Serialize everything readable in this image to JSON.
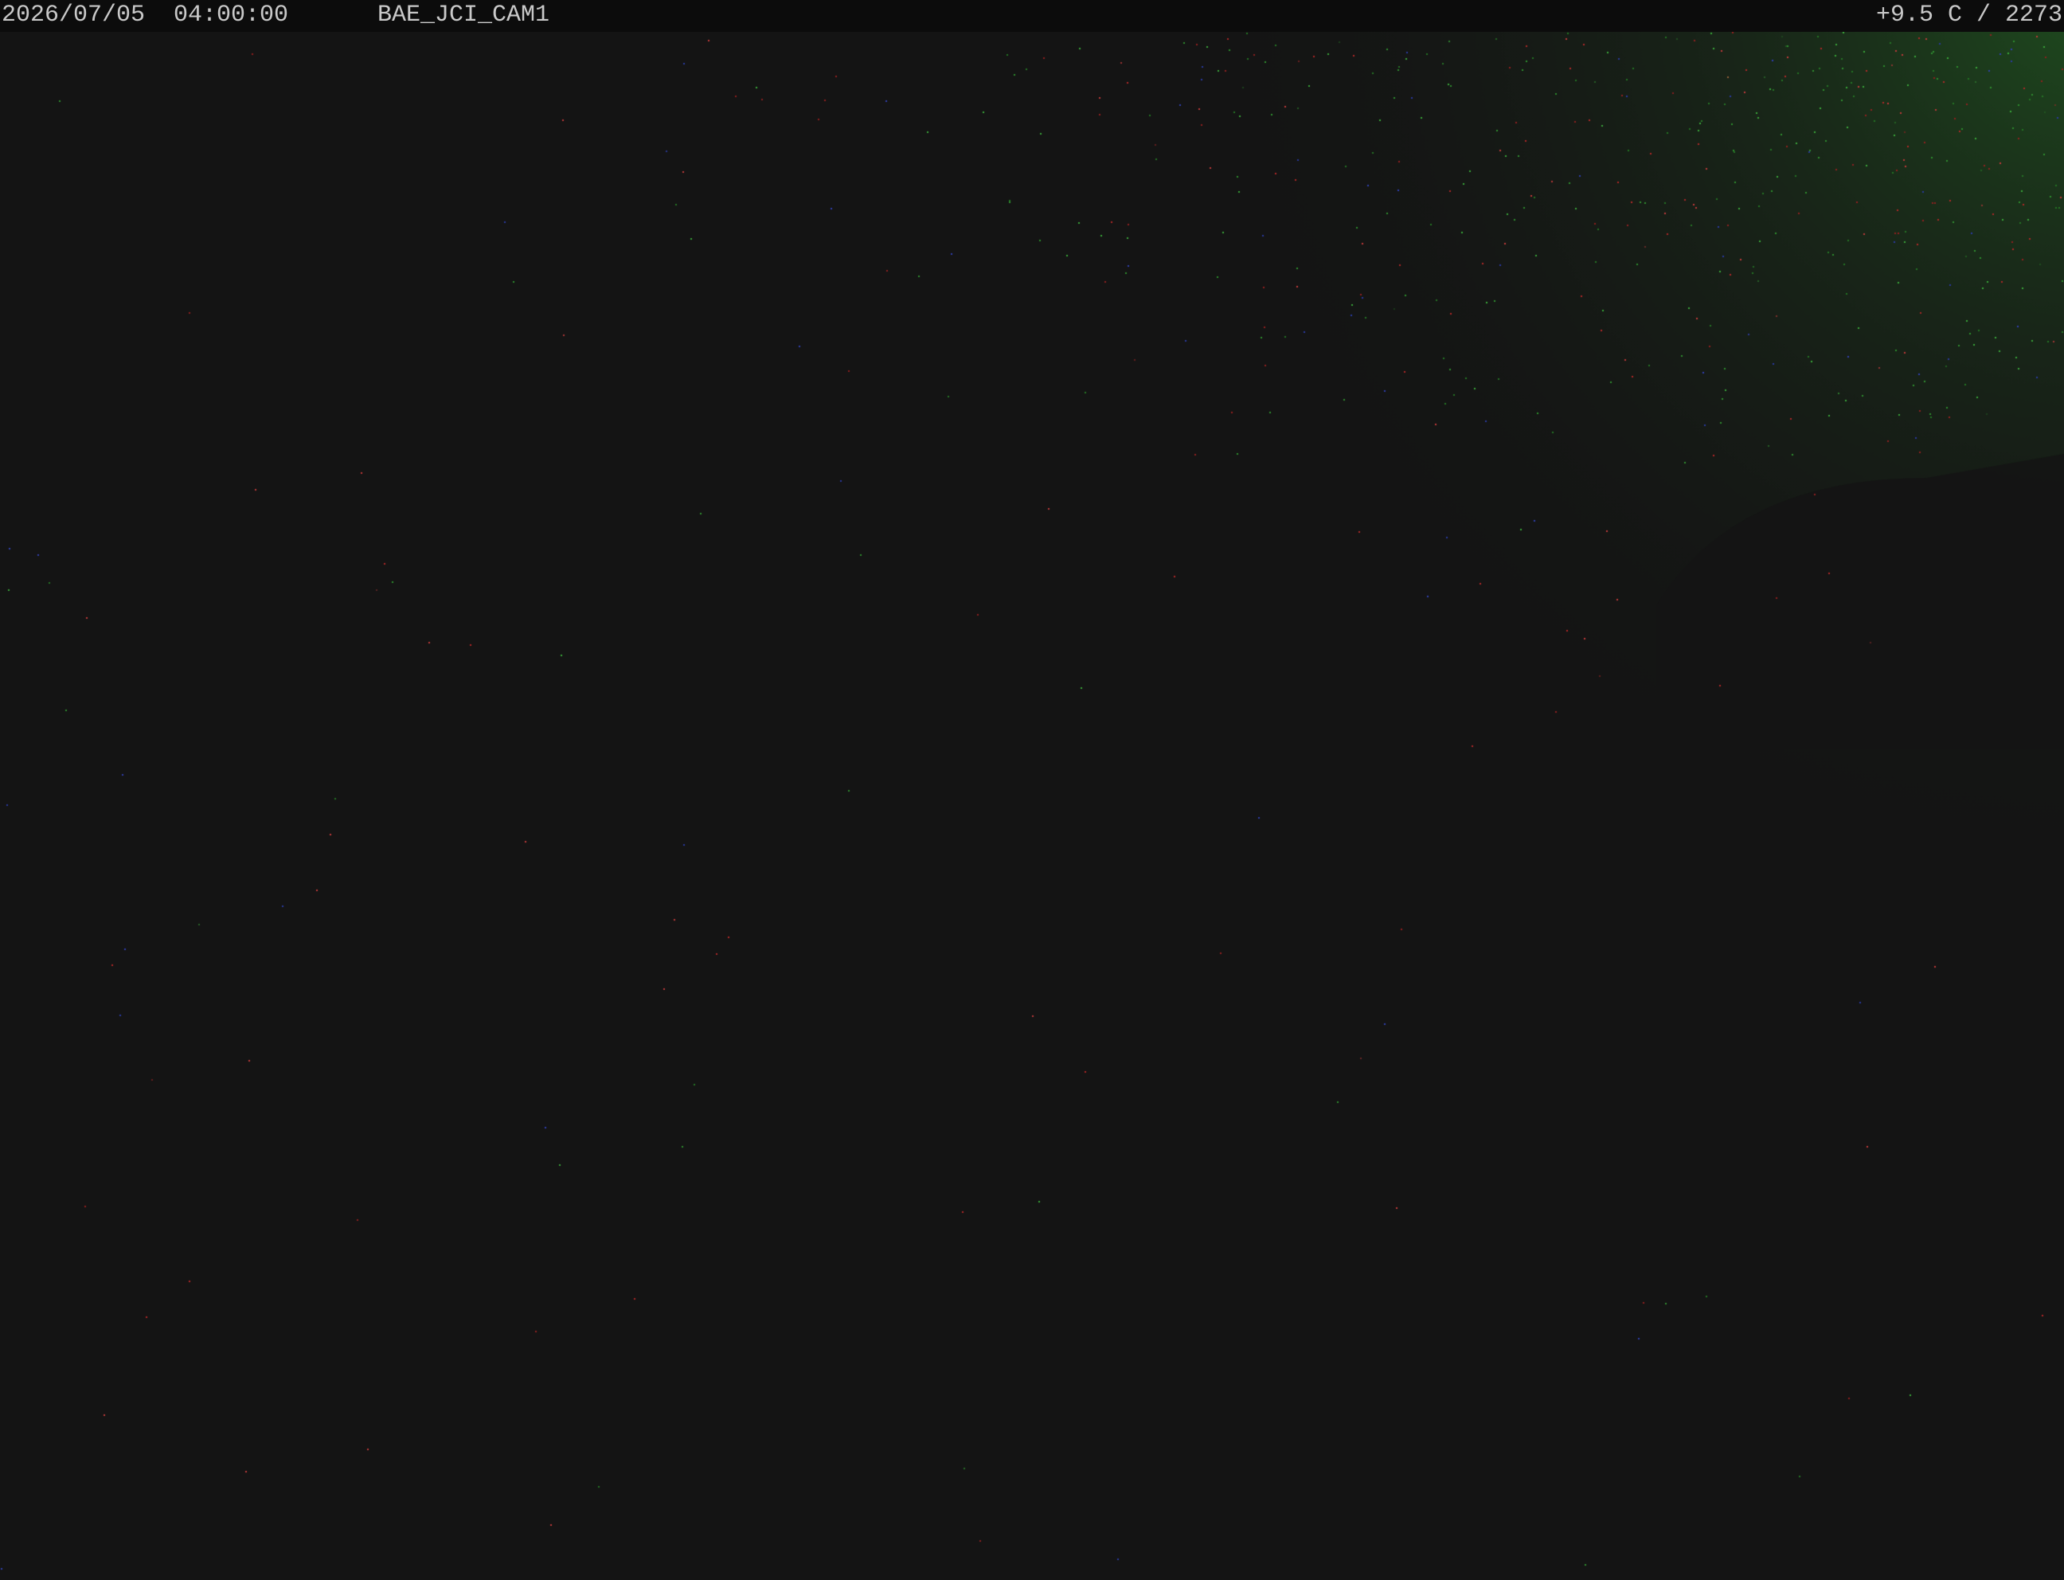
{
  "overlay": {
    "datetime": "2026/07/05  04:00:00",
    "camera_id": "BAE_JCI_CAM1",
    "temp_altitude": "+9.5 C / 2273"
  },
  "colors": {
    "background": "#141414",
    "overlay_bar": "#0c0c0c",
    "overlay_text": "#c9c9c9",
    "glow": "#2a7a2a",
    "noise_red": "#b03030",
    "noise_green": "#3a9a3a",
    "noise_blue": "#3040b0"
  }
}
